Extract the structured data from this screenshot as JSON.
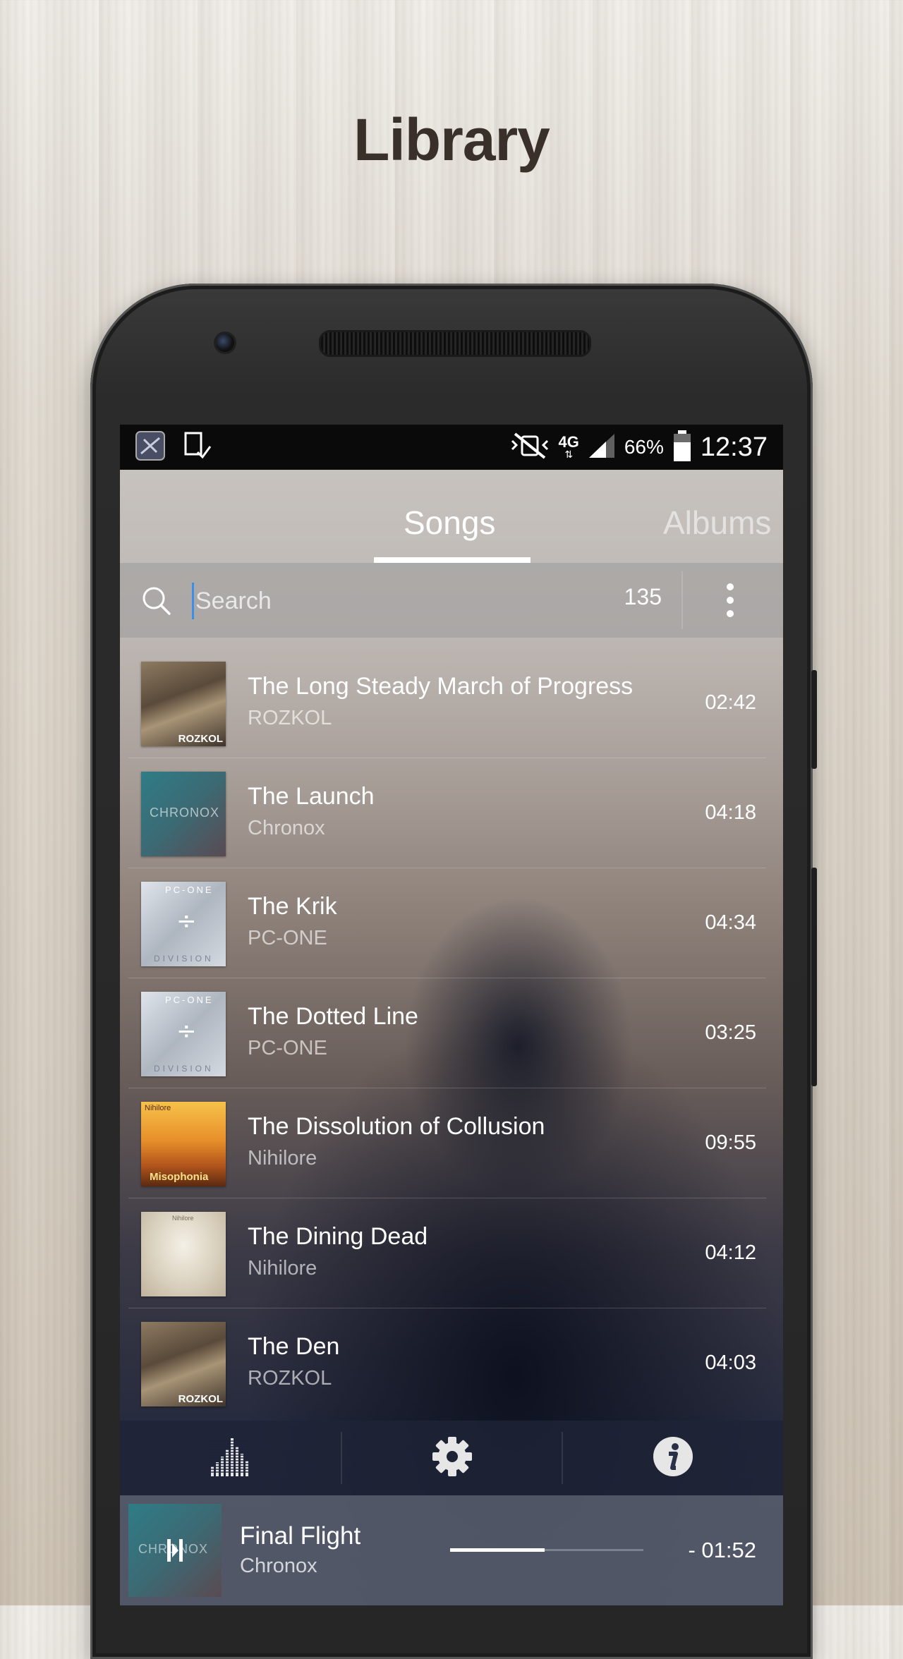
{
  "page_title": "Library",
  "status_bar": {
    "network": "4G",
    "battery_percent": "66%",
    "time": "12:37"
  },
  "tabs": [
    {
      "label": "Songs",
      "active": true
    },
    {
      "label": "Albums",
      "active": false
    }
  ],
  "search": {
    "placeholder": "Search",
    "value": "",
    "count": "135"
  },
  "songs": [
    {
      "title": "The Long Steady March of Progress",
      "artist": "ROZKOL",
      "duration": "02:42",
      "art": "rozkol"
    },
    {
      "title": "The Launch",
      "artist": "Chronox",
      "duration": "04:18",
      "art": "chronox"
    },
    {
      "title": "The Krik",
      "artist": "PC-ONE",
      "duration": "04:34",
      "art": "pcone"
    },
    {
      "title": "The Dotted Line",
      "artist": "PC-ONE",
      "duration": "03:25",
      "art": "pcone"
    },
    {
      "title": "The Dissolution of Collusion",
      "artist": "Nihilore",
      "duration": "09:55",
      "art": "misophonia"
    },
    {
      "title": "The Dining Dead",
      "artist": "Nihilore",
      "duration": "04:12",
      "art": "nihilore"
    },
    {
      "title": "The Den",
      "artist": "ROZKOL",
      "duration": "04:03",
      "art": "rozkol"
    }
  ],
  "album_art_text": {
    "rozkol": "ROZKOL",
    "chronox": "CHRONOX",
    "pcone_top": "PC-ONE",
    "pcone_bottom": "DIVISION",
    "misophonia_top": "Nihilore",
    "misophonia_bottom": "Misophonia",
    "nihilore_top": "Nihilore"
  },
  "bottom_bar": {
    "icons": [
      "equalizer-icon",
      "gear-icon",
      "info-icon"
    ]
  },
  "now_playing": {
    "title": "Final Flight",
    "artist": "Chronox",
    "remaining": "- 01:52",
    "progress": 0.49,
    "state": "paused"
  },
  "colors": {
    "accent_cursor": "#3b8fe8",
    "title_text": "#3a302a"
  }
}
